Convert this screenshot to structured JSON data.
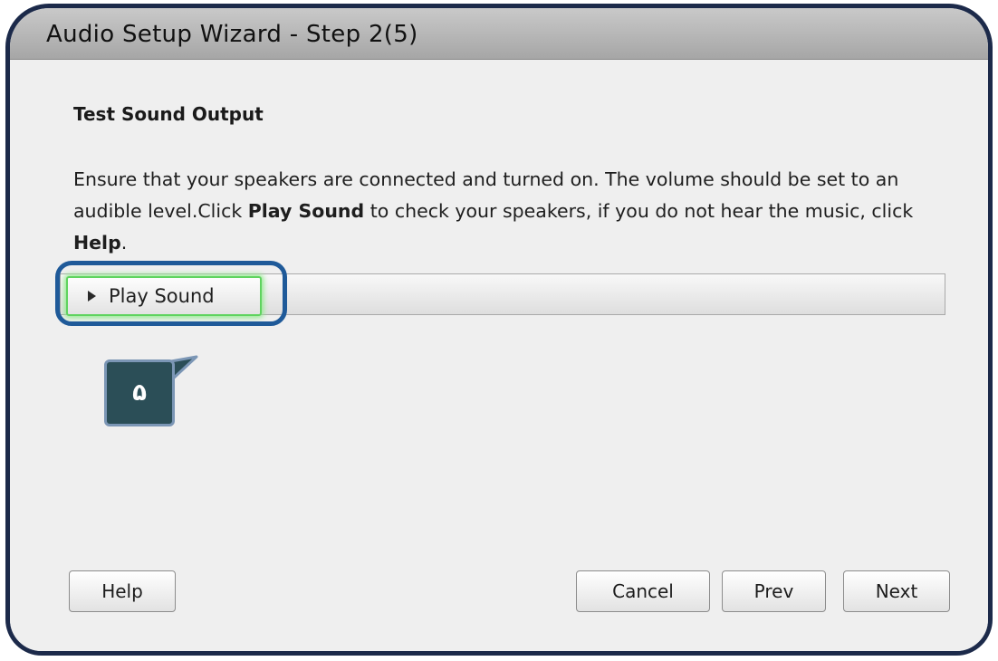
{
  "window": {
    "title": "Audio Setup Wizard - Step 2(5)"
  },
  "section": {
    "title": "Test Sound Output"
  },
  "instructions": {
    "part1": "Ensure that your speakers are connected and turned on. The volume should be set to an audible level.Click ",
    "bold1": "Play Sound",
    "part2": " to check your speakers, if you do not hear the music, click ",
    "bold2": "Help",
    "part3": "."
  },
  "play_button": {
    "label": "Play Sound",
    "icon": "play-icon",
    "highlight_color": "#5fd35f"
  },
  "annotation": {
    "label": "۵",
    "box_color": "#2b4e57",
    "outline_color": "#1f5a99"
  },
  "buttons": {
    "help": "Help",
    "cancel": "Cancel",
    "prev": "Prev",
    "next": "Next"
  }
}
